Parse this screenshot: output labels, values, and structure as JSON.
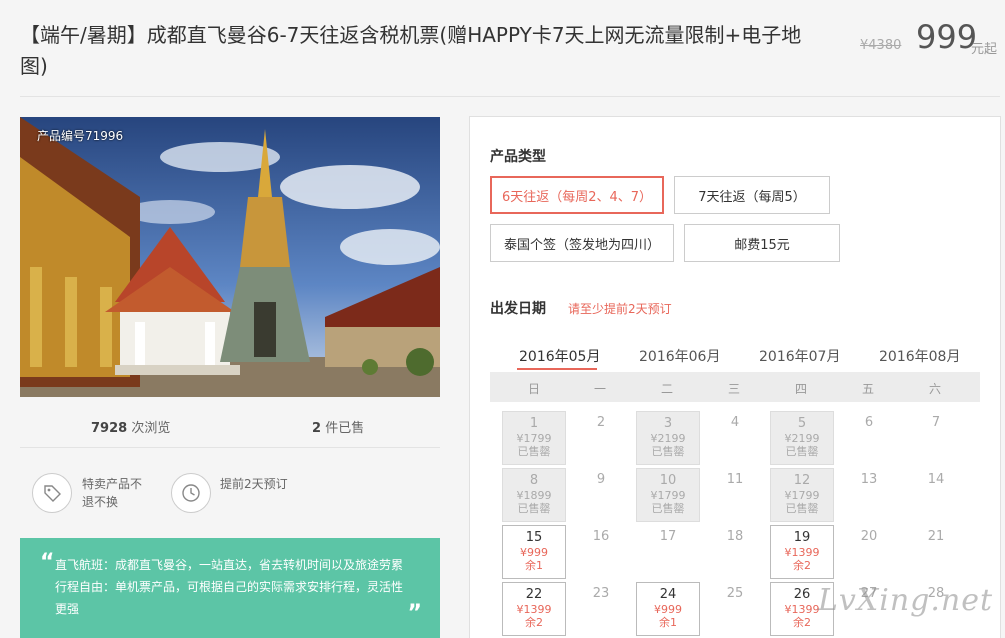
{
  "header": {
    "title": "【端午/暑期】成都直飞曼谷6-7天往返含税机票(赠HAPPY卡7天上网无流量限制+电子地图)",
    "original_price": "¥4380",
    "price": "999",
    "price_unit": "元起"
  },
  "product": {
    "id_label": "产品编号71996",
    "views_count": "7928",
    "views_label": "次浏览",
    "sold_count": "2",
    "sold_label": "件已售"
  },
  "features": [
    {
      "icon": "tag-icon",
      "text": "特卖产品不退不换"
    },
    {
      "icon": "clock-icon",
      "text": "提前2天预订"
    }
  ],
  "quote": {
    "lines": [
      "直飞航班：成都直飞曼谷，一站直达，省去转机时间以及旅途劳累",
      "行程自由：单机票产品，可根据自己的实际需求安排行程，灵活性",
      "更强"
    ]
  },
  "booking": {
    "product_type_title": "产品类型",
    "options": [
      {
        "label": "6天往返（每周2、4、7）",
        "selected": true
      },
      {
        "label": "7天往返（每周5）",
        "selected": false
      },
      {
        "label": "泰国个签（签发地为四川）",
        "selected": false
      },
      {
        "label": "邮费15元",
        "selected": false
      }
    ],
    "date_title": "出发日期",
    "date_hint": "请至少提前2天预订",
    "months": [
      "2016年05月",
      "2016年06月",
      "2016年07月",
      "2016年08月"
    ],
    "weekdays": [
      "日",
      "一",
      "二",
      "三",
      "四",
      "五",
      "六"
    ],
    "days": [
      {
        "day": "1",
        "price": "¥1799",
        "status": "已售罄",
        "state": "soldout"
      },
      {
        "day": "2",
        "state": "empty"
      },
      {
        "day": "3",
        "price": "¥2199",
        "status": "已售罄",
        "state": "soldout"
      },
      {
        "day": "4",
        "state": "empty"
      },
      {
        "day": "5",
        "price": "¥2199",
        "status": "已售罄",
        "state": "soldout"
      },
      {
        "day": "6",
        "state": "empty"
      },
      {
        "day": "7",
        "state": "empty"
      },
      {
        "day": "8",
        "price": "¥1899",
        "status": "已售罄",
        "state": "soldout"
      },
      {
        "day": "9",
        "state": "empty"
      },
      {
        "day": "10",
        "price": "¥1799",
        "status": "已售罄",
        "state": "soldout"
      },
      {
        "day": "11",
        "state": "empty"
      },
      {
        "day": "12",
        "price": "¥1799",
        "status": "已售罄",
        "state": "soldout"
      },
      {
        "day": "13",
        "state": "empty"
      },
      {
        "day": "14",
        "state": "empty"
      },
      {
        "day": "15",
        "price": "¥999",
        "status": "余1",
        "state": "avail"
      },
      {
        "day": "16",
        "state": "empty"
      },
      {
        "day": "17",
        "state": "empty"
      },
      {
        "day": "18",
        "state": "empty"
      },
      {
        "day": "19",
        "price": "¥1399",
        "status": "余2",
        "state": "avail"
      },
      {
        "day": "20",
        "state": "empty"
      },
      {
        "day": "21",
        "state": "empty"
      },
      {
        "day": "22",
        "price": "¥1399",
        "status": "余2",
        "state": "avail"
      },
      {
        "day": "23",
        "state": "empty"
      },
      {
        "day": "24",
        "price": "¥999",
        "status": "余1",
        "state": "avail"
      },
      {
        "day": "25",
        "state": "empty"
      },
      {
        "day": "26",
        "price": "¥1399",
        "status": "余2",
        "state": "avail"
      },
      {
        "day": "27",
        "state": "empty"
      },
      {
        "day": "28",
        "state": "empty"
      }
    ]
  },
  "watermark": "LvXing.net",
  "colors": {
    "accent": "#e8675a",
    "quote_bg": "#5cc5a6"
  }
}
